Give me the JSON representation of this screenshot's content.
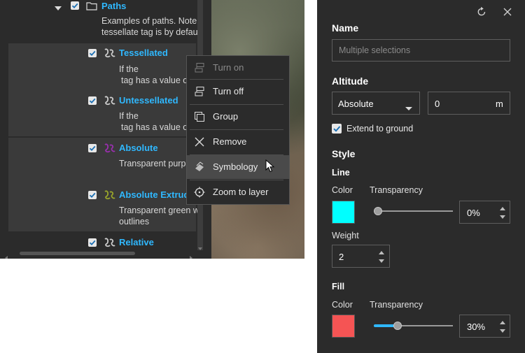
{
  "layers": {
    "folder": {
      "name": "Paths",
      "description_lines": [
        "Examples of paths. Note",
        "tessellate tag is by defau"
      ]
    },
    "items": [
      {
        "name": "Tessellated",
        "description_lines": [
          "If the",
          "tag has a value o"
        ],
        "icon": "path-icon",
        "icon_color": "#cfcfcf"
      },
      {
        "name": "Untessellated",
        "description_lines": [
          "If the",
          "tag has a value o"
        ],
        "icon": "path-icon",
        "icon_color": "#cfcfcf"
      },
      {
        "name": "Absolute",
        "description_lines": [
          "Transparent purp"
        ],
        "icon": "path-icon",
        "icon_color": "#9b2fb0"
      },
      {
        "name": "Absolute Extrude",
        "description_lines": [
          "Transparent green w",
          "outlines"
        ],
        "icon": "path-icon",
        "icon_color": "#9aa72a"
      },
      {
        "name": "Relative",
        "description_lines": [],
        "icon": "path-icon",
        "icon_color": "#cfcfcf"
      }
    ]
  },
  "context_menu": {
    "items": [
      {
        "label": "Turn on",
        "icon": "layer-on-icon",
        "disabled": true
      },
      {
        "label": "Turn off",
        "icon": "layer-off-icon",
        "disabled": false
      },
      {
        "label": "Group",
        "icon": "group-icon",
        "disabled": false
      },
      {
        "label": "Remove",
        "icon": "close-icon",
        "disabled": false
      },
      {
        "label": "Symbology",
        "icon": "symbology-icon",
        "disabled": false,
        "highlighted": true
      },
      {
        "label": "Zoom to layer",
        "icon": "zoom-to-layer-icon",
        "disabled": false
      }
    ]
  },
  "properties": {
    "name_heading": "Name",
    "name_placeholder": "Multiple selections",
    "altitude_heading": "Altitude",
    "altitude_mode": "Absolute",
    "altitude_value": "0",
    "altitude_unit": "m",
    "extend_label": "Extend to ground",
    "extend_checked": true,
    "style_heading": "Style",
    "line": {
      "heading": "Line",
      "color_label": "Color",
      "color": "#00ffff",
      "transparency_label": "Transparency",
      "transparency_value": "0%",
      "transparency_fraction": 0.0,
      "weight_label": "Weight",
      "weight_value": "2"
    },
    "fill": {
      "heading": "Fill",
      "color_label": "Color",
      "color": "#f55454",
      "transparency_label": "Transparency",
      "transparency_value": "30%",
      "transparency_fraction": 0.3
    }
  }
}
